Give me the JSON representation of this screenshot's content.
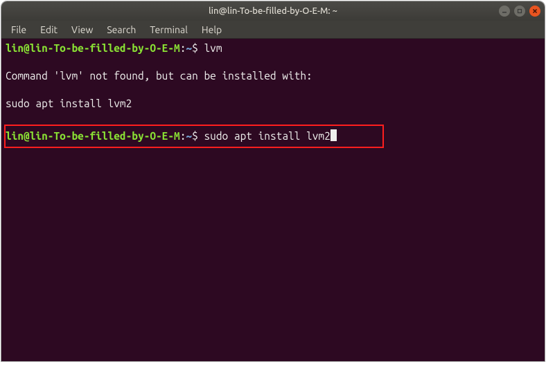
{
  "window": {
    "title": "lin@lin-To-be-filled-by-O-E-M: ~"
  },
  "menubar": {
    "file": "File",
    "edit": "Edit",
    "view": "View",
    "search": "Search",
    "terminal": "Terminal",
    "help": "Help"
  },
  "terminal": {
    "prompt_userhost": "lin@lin-To-be-filled-by-O-E-M",
    "prompt_colon": ":",
    "prompt_path": "~",
    "prompt_dollar": "$ ",
    "line1_cmd": "lvm",
    "line2": "Command 'lvm' not found, but can be installed with:",
    "line3": "sudo apt install lvm2",
    "line4_cmd": "sudo apt install lvm2"
  }
}
